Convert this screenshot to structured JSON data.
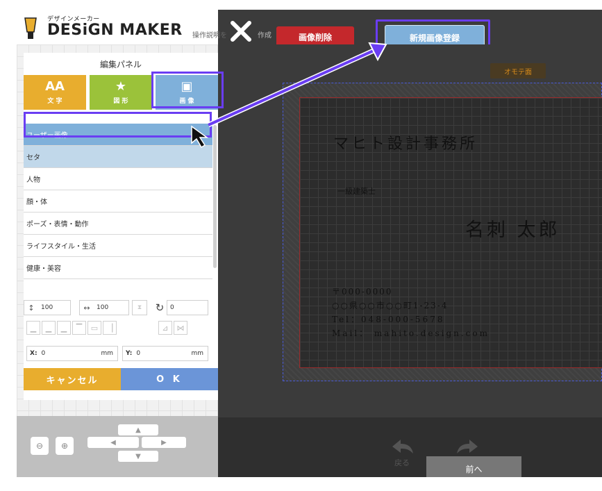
{
  "header": {
    "logo_kana": "デザインメーカー",
    "logo_text": "DESiGN MAKER",
    "desc": "操作説明を",
    "desc2": "作成",
    "delete_label": "画像削除",
    "register_label": "新規画像登録"
  },
  "panel": {
    "title": "編集パネル",
    "tabs": [
      {
        "glyph": "AA",
        "label": "文 字"
      },
      {
        "glyph": "★",
        "label": "図 形"
      },
      {
        "glyph": "▣",
        "label": "画 像"
      }
    ],
    "categories": [
      "ユーザー画像",
      "セタ",
      "人物",
      "顔・体",
      "ポーズ・表情・動作",
      "ライフスタイル・生活",
      "健康・美容"
    ],
    "height_value": "100",
    "width_value": "100",
    "rotate_value": "0",
    "x_label": "X:",
    "x_value": "0",
    "y_label": "Y:",
    "y_value": "0",
    "unit": "mm",
    "cancel_label": "キャンセル",
    "ok_label": "O K"
  },
  "card": {
    "side_badge": "オモテ面",
    "company": "マヒト設計事務所",
    "title": "一級建築士",
    "name": "名刺 太郎",
    "postal": "〒000-0000",
    "address": "○○県○○市○○町1-23-4",
    "tel": "Tel：048-000-5678",
    "mail": "Mail： mahito.design.com"
  },
  "footer": {
    "undo_label": "戻る",
    "prev_label": "前へ"
  },
  "colors": {
    "highlight": "#6a3df3",
    "delete": "#c4282c",
    "register": "#7fb0da",
    "text_tab": "#e8ad2e",
    "shape_tab": "#9bc23a",
    "image_tab": "#7fb0da",
    "ok": "#6b95d8"
  }
}
